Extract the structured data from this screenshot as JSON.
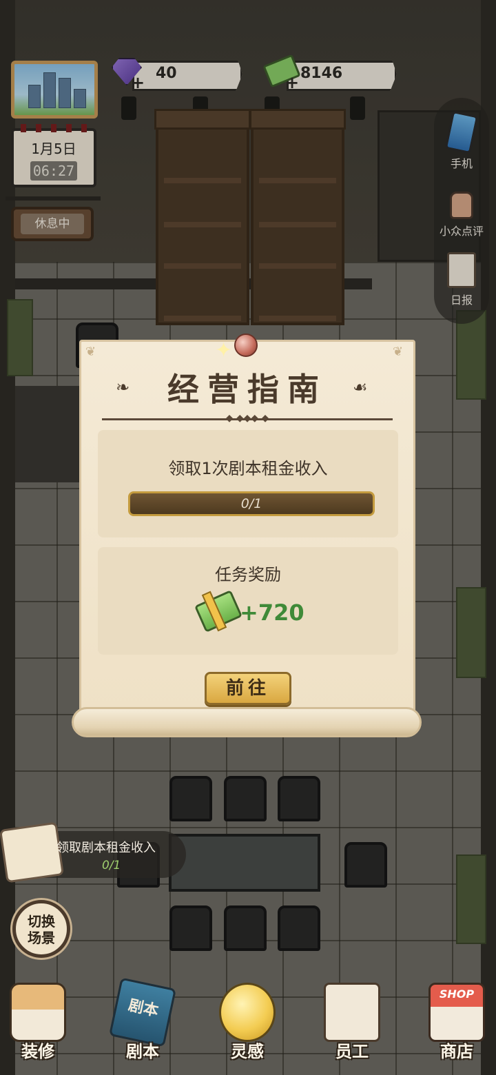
{
  "hud": {
    "gems": "40",
    "cash": "8146",
    "plus": "+",
    "calendar_date": "1月5日",
    "calendar_time": "06:27",
    "status_sign": "休息中"
  },
  "side_menu": [
    {
      "label": "手机",
      "icon": "phone-icon"
    },
    {
      "label": "小众点评",
      "icon": "thumbs-up-icon"
    },
    {
      "label": "日报",
      "icon": "clipboard-icon"
    }
  ],
  "modal": {
    "title": "经营指南",
    "task_text": "领取1次剧本租金收入",
    "progress_text": "0/1",
    "progress_value": 0,
    "reward_title": "任务奖励",
    "reward_value": "+720",
    "go_button": "前往"
  },
  "quest_tracker": {
    "label": "领取剧本租金收入",
    "progress": "0/1"
  },
  "switch_scene": "切换场景",
  "bottom_nav": [
    {
      "label": "装修",
      "icon": "house-icon"
    },
    {
      "label": "剧本",
      "icon": "script-book-icon",
      "icon_text": "剧本"
    },
    {
      "label": "灵感",
      "icon": "lightbulb-icon"
    },
    {
      "label": "员工",
      "icon": "staff-badge-icon"
    },
    {
      "label": "商店",
      "icon": "shop-icon",
      "icon_text": "SHOP"
    }
  ],
  "colors": {
    "accent_gold": "#d9a841",
    "reward_green": "#3f8a38",
    "parchment": "#f4ead6"
  }
}
